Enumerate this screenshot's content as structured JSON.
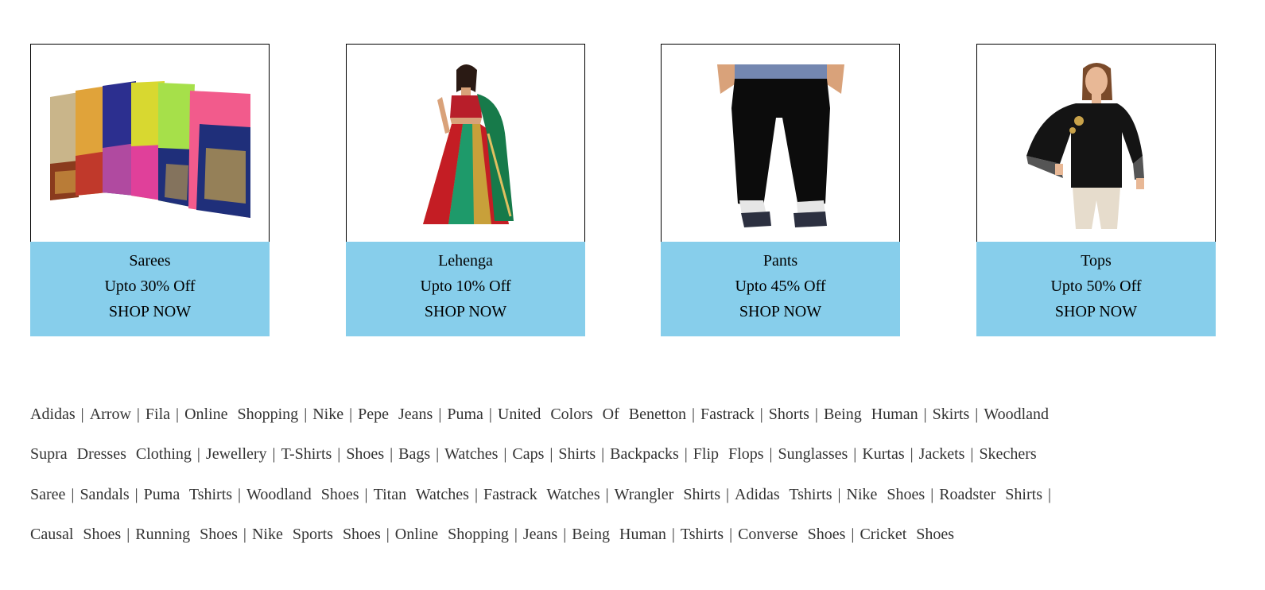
{
  "cards": [
    {
      "name": "Sarees",
      "offer": "Upto 30% Off",
      "cta": "SHOP NOW"
    },
    {
      "name": "Lehenga",
      "offer": "Upto 10% Off",
      "cta": "SHOP NOW"
    },
    {
      "name": "Pants",
      "offer": "Upto 45% Off",
      "cta": "SHOP NOW"
    },
    {
      "name": "Tops",
      "offer": "Upto 50% Off",
      "cta": "SHOP NOW"
    }
  ],
  "brand_links": [
    [
      "Adidas",
      "Arrow",
      "Fila",
      "Online Shopping",
      "Nike",
      "Pepe Jeans",
      "Puma",
      "United Colors Of Benetton",
      "Fastrack",
      "Shorts",
      "Being Human",
      "Skirts",
      "Woodland"
    ],
    [
      "Supra Dresses Clothing",
      "Jewellery",
      "T-Shirts",
      "Shoes",
      "Bags",
      "Watches",
      "Caps",
      "Shirts",
      "Backpacks",
      "Flip Flops",
      "Sunglasses",
      "Kurtas",
      "Jackets",
      "Skechers"
    ],
    [
      "Saree",
      "Sandals",
      "Puma Tshirts",
      "Woodland Shoes",
      "Titan Watches",
      "Fastrack Watches",
      "Wrangler Shirts",
      "Adidas Tshirts",
      "Nike Shoes",
      "Roadster Shirts"
    ],
    [
      "Causal Shoes",
      "Running Shoes",
      "Nike Sports Shoes",
      "Online Shopping",
      "Jeans",
      "Being Human",
      "Tshirts",
      "Converse Shoes",
      "Cricket Shoes"
    ]
  ],
  "separator": "|",
  "colors": {
    "card_footer": "#87ceeb",
    "link_text": "#333333"
  }
}
